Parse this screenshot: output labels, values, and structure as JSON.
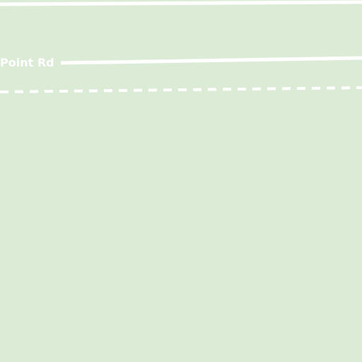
{
  "map": {
    "background_color": "#dbebd6",
    "road_color": "#ffffff",
    "roads": [
      {
        "name": "",
        "style": "solid"
      },
      {
        "name": "Point Rd",
        "style": "solid"
      },
      {
        "name": "",
        "style": "dashed"
      }
    ]
  }
}
